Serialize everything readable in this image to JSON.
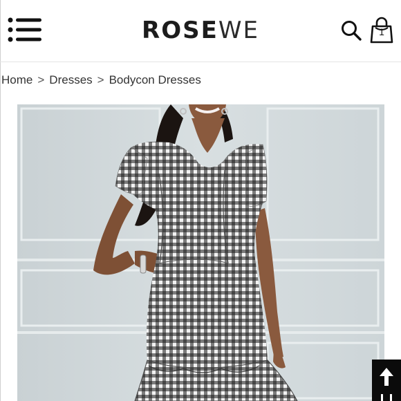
{
  "header": {
    "logo_primary": "ROSE",
    "logo_secondary": "WE",
    "cart_count": "1"
  },
  "breadcrumb": {
    "items": [
      "Home",
      "Dresses"
    ],
    "current": "Bodycon Dresses",
    "separator": ">"
  },
  "product": {
    "image_icon": "gingham-bodycon-dress-photo",
    "colors": {
      "background": "#d3dadd",
      "pattern_dark": "#1a1a1a",
      "pattern_light": "#f2f2f2"
    }
  },
  "controls": {
    "menu_icon": "hamburger-menu-icon",
    "search_icon": "search-icon",
    "bag_icon": "shopping-bag-icon",
    "back_to_top_icon": "arrow-up-icon"
  }
}
